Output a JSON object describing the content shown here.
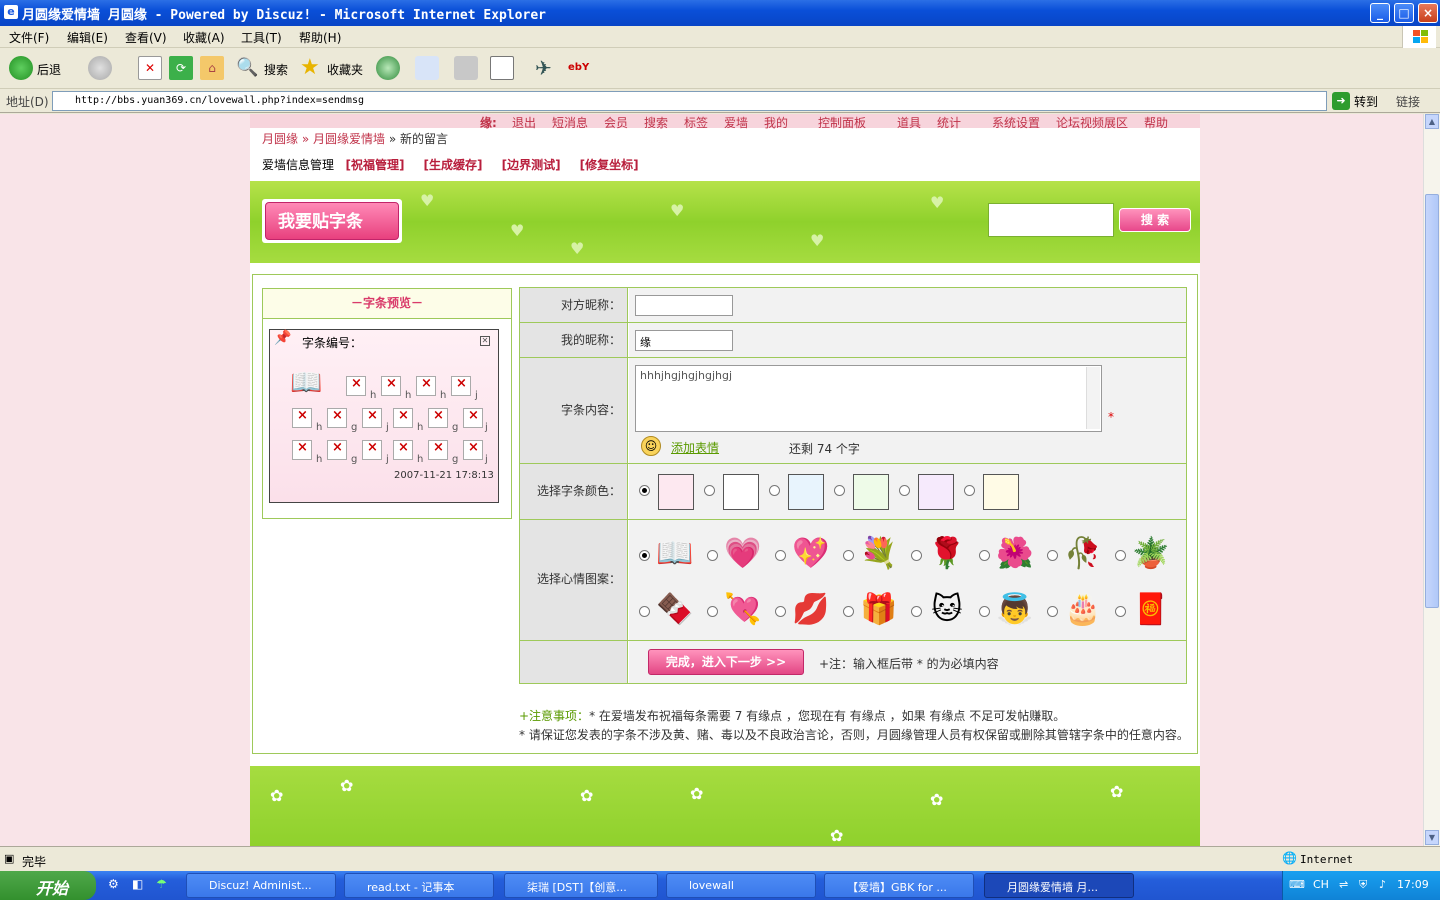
{
  "window": {
    "title": "月圆缘爱情墙 月圆缘 - Powered by Discuz! - Microsoft Internet Explorer",
    "buttons": {
      "minimize": "_",
      "maximize": "□",
      "close": "×"
    }
  },
  "menubar": [
    "文件(F)",
    "编辑(E)",
    "查看(V)",
    "收藏(A)",
    "工具(T)",
    "帮助(H)"
  ],
  "toolbar": {
    "back": "后退",
    "search": "搜索",
    "favorites": "收藏夹"
  },
  "address": {
    "label": "地址(D)",
    "url": "http://bbs.yuan369.cn/lovewall.php?index=sendmsg",
    "go": "转到",
    "links": "链接"
  },
  "topnav": [
    "缘:",
    "退出",
    "短消息",
    "会员",
    "搜索",
    "标签",
    "爱墙",
    "我的",
    "控制面板",
    "道具",
    "统计",
    "系统设置",
    "论坛视频展区",
    "帮助"
  ],
  "breadcrumb": {
    "home": "月圆缘",
    "wall": "月圆缘爱情墙",
    "current": "新的留言",
    "sep": "»"
  },
  "admin": {
    "label": "爱墙信息管理",
    "links": [
      "[祝福管理]",
      "[生成缓存]",
      "[边界测试]",
      "[修复坐标]"
    ]
  },
  "banner": {
    "post_button": "我要贴字条",
    "search_button": "搜 索",
    "search_value": ""
  },
  "preview": {
    "title": "－字条预览－",
    "number_label": "字条编号：",
    "row1_chars": [
      "h",
      "h",
      "h",
      "j"
    ],
    "row2_chars": [
      "h",
      "g",
      "j",
      "h",
      "g",
      "j"
    ],
    "row3_chars": [
      "h",
      "g",
      "j",
      "h",
      "g",
      "j"
    ],
    "date": "2007-11-21 17:8:13"
  },
  "form": {
    "target_label": "对方昵称：",
    "target_value": "",
    "my_label": "我的昵称：",
    "my_value": "缘",
    "content_label": "字条内容：",
    "content_value": "hhhjhgjhgjhgjhgj",
    "required_mark": "*",
    "add_emoticon": "添加表情",
    "remaining": "还剩  74 个字",
    "color_label": "选择字条颜色：",
    "colors": [
      "#fde8f0",
      "#ffffff",
      "#e8f4fd",
      "#eefbe8",
      "#f6eafc",
      "#fffbe6"
    ],
    "selected_color_index": 0,
    "mood_label": "选择心情图案：",
    "moods": [
      "📖",
      "💗",
      "💖",
      "💐",
      "🌹",
      "🌺",
      "🥀",
      "🪴",
      "🍫",
      "💘",
      "💋",
      "🎁",
      "🐱",
      "👼",
      "🎂",
      "🧧"
    ],
    "selected_mood_index": 0,
    "submit": "完成，进入下一步 >>",
    "note": "+注：输入框后带 * 的为必填内容"
  },
  "tips": {
    "line1_prefix": "+注意事项：",
    "line1": "* 在爱墙发布祝福每条需要  7 有缘点 ，您现在有  有缘点 ，如果  有缘点  不足可发帖赚取。",
    "line2": "* 请保证您发表的字条不涉及黄、赌、毒以及不良政治言论，否则，月圆缘管理人员有权保留或删除其管辖字条中的任意内容。"
  },
  "status": {
    "text": "完毕",
    "zone": "Internet"
  },
  "taskbar": {
    "start": "开始",
    "tasks": [
      "Discuz! Administ...",
      "read.txt - 记事本",
      "柒瑞 [DST]【创意...",
      "lovewall",
      "【爱墙】GBK for ...",
      "月圆缘爱情墙 月..."
    ],
    "lang": "CH",
    "clock": "17:09"
  }
}
